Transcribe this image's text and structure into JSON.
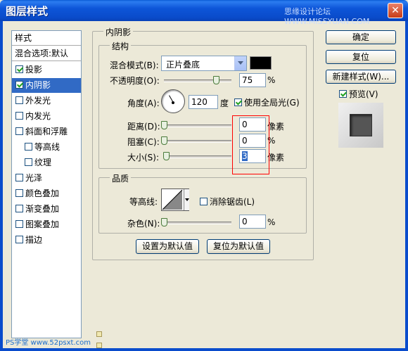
{
  "window": {
    "title": "图层样式",
    "watermark": "思缘设计论坛 WWW.MISSYUAN.COM"
  },
  "styles_list": {
    "header": "样式",
    "blend_options": "混合选项:默认",
    "items": [
      {
        "label": "投影",
        "checked": true,
        "selected": false
      },
      {
        "label": "内阴影",
        "checked": true,
        "selected": true
      },
      {
        "label": "外发光",
        "checked": false,
        "selected": false
      },
      {
        "label": "内发光",
        "checked": false,
        "selected": false
      },
      {
        "label": "斜面和浮雕",
        "checked": false,
        "selected": false
      },
      {
        "label": "等高线",
        "checked": false,
        "selected": false
      },
      {
        "label": "纹理",
        "checked": false,
        "selected": false
      },
      {
        "label": "光泽",
        "checked": false,
        "selected": false
      },
      {
        "label": "颜色叠加",
        "checked": false,
        "selected": false
      },
      {
        "label": "渐变叠加",
        "checked": false,
        "selected": false
      },
      {
        "label": "图案叠加",
        "checked": false,
        "selected": false
      },
      {
        "label": "描边",
        "checked": false,
        "selected": false
      }
    ]
  },
  "inner_shadow": {
    "group_title": "内阴影",
    "structure_title": "结构",
    "blend_mode_label": "混合模式(B):",
    "blend_mode_value": "正片叠底",
    "blend_color": "#000000",
    "opacity_label": "不透明度(O):",
    "opacity_value": "75",
    "opacity_unit": "%",
    "angle_label": "角度(A):",
    "angle_value": "120",
    "angle_unit": "度",
    "global_light_label": "使用全局光(G)",
    "global_light_checked": true,
    "distance_label": "距离(D):",
    "distance_value": "0",
    "distance_unit": "像素",
    "choke_label": "阻塞(C):",
    "choke_value": "0",
    "choke_unit": "%",
    "size_label": "大小(S):",
    "size_value": "3",
    "size_unit": "像素"
  },
  "quality": {
    "title": "品质",
    "contour_label": "等高线:",
    "anti_alias_label": "消除锯齿(L)",
    "anti_alias_checked": false,
    "noise_label": "杂色(N):",
    "noise_value": "0",
    "noise_unit": "%"
  },
  "bottom_buttons": {
    "make_default": "设置为默认值",
    "reset_default": "复位为默认值"
  },
  "right_panel": {
    "ok": "确定",
    "reset": "复位",
    "new_style": "新建样式(W)...",
    "preview_label": "预览(V)",
    "preview_checked": true
  },
  "footer": {
    "watermark": "PS学堂 www.52psxt.com"
  }
}
